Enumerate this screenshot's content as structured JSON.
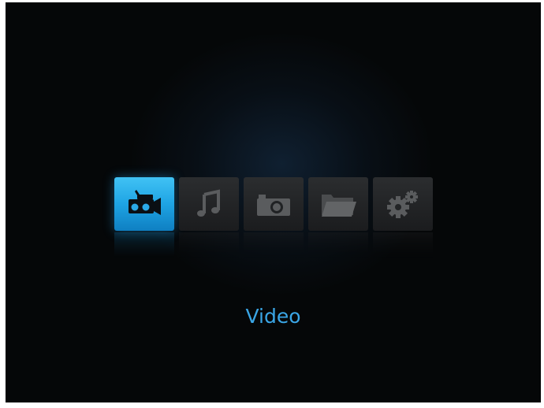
{
  "menu": {
    "items": [
      {
        "id": "video",
        "icon": "video-camera-icon",
        "selected": true
      },
      {
        "id": "music",
        "icon": "music-note-icon",
        "selected": false
      },
      {
        "id": "photo",
        "icon": "camera-icon",
        "selected": false
      },
      {
        "id": "files",
        "icon": "folder-icon",
        "selected": false
      },
      {
        "id": "settings",
        "icon": "gears-icon",
        "selected": false
      }
    ],
    "selected_label": "Video"
  },
  "colors": {
    "background": "#050708",
    "accent": "#3aa6e6",
    "tile_selected": "#1ea4e4",
    "tile": "#2b2d2f",
    "icon": "#5a5c5e"
  }
}
